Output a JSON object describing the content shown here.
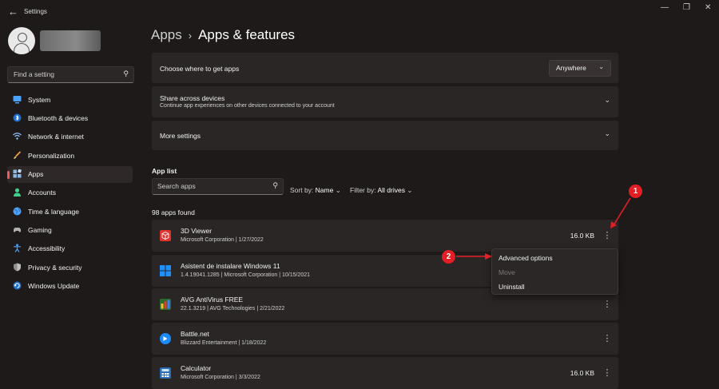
{
  "window": {
    "title": "Settings"
  },
  "sidebar": {
    "search_placeholder": "Find a setting",
    "items": [
      {
        "label": "System",
        "icon": "monitor-icon",
        "color": "#4aa3ff"
      },
      {
        "label": "Bluetooth & devices",
        "icon": "bluetooth-icon",
        "color": "#4aa3ff"
      },
      {
        "label": "Network & internet",
        "icon": "wifi-icon",
        "color": "#8fc7ff"
      },
      {
        "label": "Personalization",
        "icon": "brush-icon",
        "color": "#f0a04b"
      },
      {
        "label": "Apps",
        "icon": "apps-icon",
        "color": "#8fb7e3",
        "active": true
      },
      {
        "label": "Accounts",
        "icon": "person-icon",
        "color": "#3fd08a"
      },
      {
        "label": "Time & language",
        "icon": "globe-icon",
        "color": "#4aa3ff"
      },
      {
        "label": "Gaming",
        "icon": "controller-icon",
        "color": "#b0b0b0"
      },
      {
        "label": "Accessibility",
        "icon": "accessibility-icon",
        "color": "#4aa3ff"
      },
      {
        "label": "Privacy & security",
        "icon": "shield-icon",
        "color": "#a0a0a0"
      },
      {
        "label": "Windows Update",
        "icon": "update-icon",
        "color": "#4aa3ff"
      }
    ]
  },
  "main": {
    "breadcrumb": {
      "parent": "Apps",
      "current": "Apps & features"
    },
    "cards": {
      "get_apps": {
        "title": "Choose where to get apps",
        "dropdown_value": "Anywhere"
      },
      "share": {
        "title": "Share across devices",
        "subtitle": "Continue app experiences on other devices connected to your account"
      },
      "more": {
        "title": "More settings"
      }
    },
    "app_list": {
      "heading": "App list",
      "search_placeholder": "Search apps",
      "sort_label": "Sort by:",
      "sort_value": "Name",
      "filter_label": "Filter by:",
      "filter_value": "All drives",
      "count": "98 apps found",
      "apps": [
        {
          "name": "3D Viewer",
          "meta": "Microsoft Corporation  |  1/27/2022",
          "size": "16.0 KB",
          "icon": "cube-icon",
          "color": "#e0332f"
        },
        {
          "name": "Asistent de instalare Windows 11",
          "meta": "1.4.19041.1285  |  Microsoft Corporation  |  10/15/2021",
          "size": "",
          "icon": "windows-logo-icon",
          "color": "#1e90ff"
        },
        {
          "name": "AVG AntiVirus FREE",
          "meta": "22.1.3219  |  AVG Technologies  |  2/21/2022",
          "size": "",
          "icon": "avg-icon",
          "color": "#3a8f3a"
        },
        {
          "name": "Battle.net",
          "meta": "Blizzard Entertainment  |  1/18/2022",
          "size": "",
          "icon": "battlenet-icon",
          "color": "#1a8cff"
        },
        {
          "name": "Calculator",
          "meta": "Microsoft Corporation  |  3/3/2022",
          "size": "16.0 KB",
          "icon": "calculator-icon",
          "color": "#2a6fb8"
        }
      ]
    },
    "context_menu": {
      "items": [
        {
          "label": "Advanced options",
          "enabled": true
        },
        {
          "label": "Move",
          "enabled": false
        },
        {
          "label": "Uninstall",
          "enabled": true
        }
      ]
    },
    "annotations": [
      {
        "number": "1",
        "color": "#e31e24"
      },
      {
        "number": "2",
        "color": "#e31e24"
      }
    ]
  }
}
